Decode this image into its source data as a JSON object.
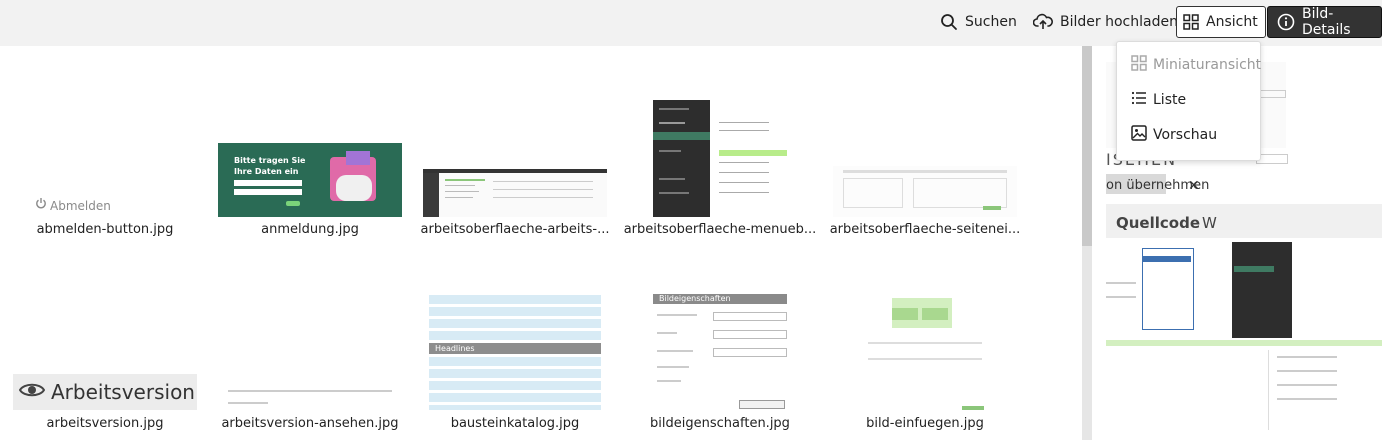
{
  "toolbar": {
    "search_label": "Suchen",
    "upload_label": "Bilder hochladen",
    "view_label": "Ansicht",
    "details_label": "Bild-Details"
  },
  "view_menu": {
    "items": [
      {
        "label": "Miniaturansicht",
        "icon": "grid-icon",
        "disabled": true
      },
      {
        "label": "Liste",
        "icon": "list-icon",
        "disabled": false
      },
      {
        "label": "Vorschau",
        "icon": "image-icon",
        "disabled": false
      }
    ]
  },
  "files": [
    {
      "name": "abmelden-button.jpg",
      "thumb_text": "Abmelden"
    },
    {
      "name": "anmeldung.jpg",
      "thumb_text": "Bitte tragen Sie Ihre Daten ein"
    },
    {
      "name": "arbeitsoberflaeche-arbeits-..."
    },
    {
      "name": "arbeitsoberflaeche-menueb..."
    },
    {
      "name": "arbeitsoberflaeche-seitenei..."
    },
    {
      "name": "arbeitsversion.jpg",
      "thumb_text": "Arbeitsversion"
    },
    {
      "name": "arbeitsversion-ansehen.jpg"
    },
    {
      "name": "bausteinkatalog.jpg",
      "thumb_text": "Headlines"
    },
    {
      "name": "bildeigenschaften.jpg",
      "thumb_text": "Bildeigenschaften"
    },
    {
      "name": "bild-einfuegen.jpg"
    }
  ],
  "preview": {
    "fragment_1": "ISEHEN",
    "fragment_2": "on übernehmen",
    "fragment_3": "Quellcode",
    "fragment_4": "W"
  },
  "colors": {
    "toolbar_bg": "#f2f2f2",
    "details_button_bg": "#333333",
    "accent_green": "#2a6b55"
  }
}
